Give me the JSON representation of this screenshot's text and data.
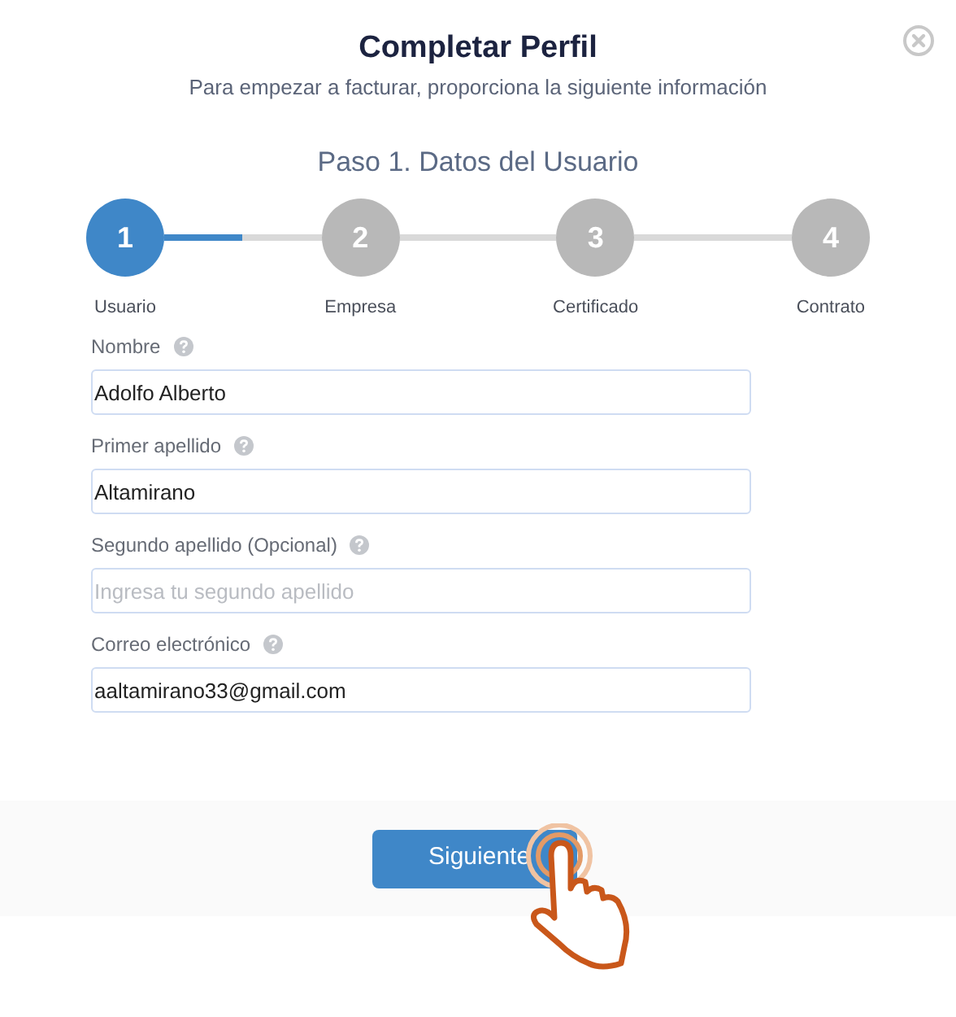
{
  "dialog": {
    "title": "Completar Perfil",
    "subtitle": "Para empezar a facturar, proporciona la siguiente información",
    "step_heading": "Paso 1. Datos del Usuario"
  },
  "stepper": {
    "connectors": [
      {
        "level": 0.5
      },
      {
        "level": 0
      },
      {
        "level": 0
      }
    ],
    "steps": [
      {
        "number": "1",
        "label": "Usuario",
        "selected": true
      },
      {
        "number": "2",
        "label": "Empresa",
        "selected": false
      },
      {
        "number": "3",
        "label": "Certificado",
        "selected": false
      },
      {
        "number": "4",
        "label": "Contrato",
        "selected": false
      }
    ]
  },
  "fields": [
    {
      "label": "Nombre",
      "value": "Adolfo Alberto"
    },
    {
      "label": "Primer apellido",
      "value": "Altamirano"
    },
    {
      "label": "Segundo apellido (Opcional)",
      "placeholder": "Ingresa tu segundo apellido"
    },
    {
      "label": "Correo electrónico",
      "value": "aaltamirano33@gmail.com"
    }
  ],
  "buttons": [
    "Siguiente"
  ]
}
